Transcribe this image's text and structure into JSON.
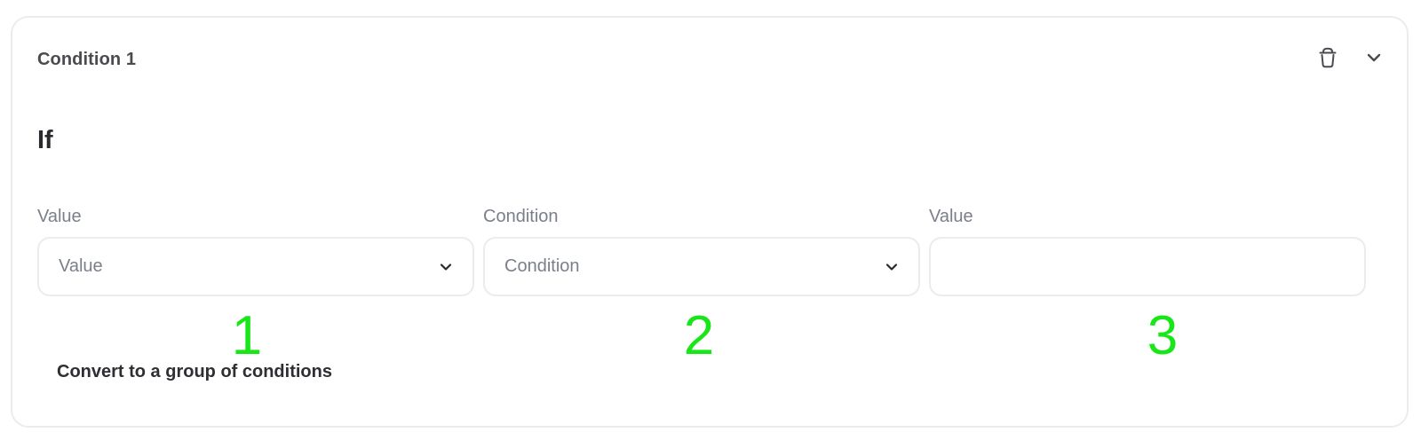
{
  "condition_card": {
    "title": "Condition 1",
    "icons": {
      "delete": "trash-icon",
      "collapse": "chevron-down-icon"
    }
  },
  "section": {
    "if_label": "If"
  },
  "fields": {
    "left": {
      "label": "Value",
      "placeholder": "Value",
      "icon": "chevron-down-icon"
    },
    "operator": {
      "label": "Condition",
      "placeholder": "Condition",
      "icon": "chevron-down-icon"
    },
    "right": {
      "label": "Value",
      "value": ""
    }
  },
  "markers": [
    "1",
    "2",
    "3"
  ],
  "actions": {
    "convert_label": "Convert to a group of conditions"
  },
  "colors": {
    "border": "#ececee",
    "title": "#4a4a4f",
    "label": "#7a7f8a",
    "marker": "#19e619",
    "text": "#2e2e33"
  }
}
